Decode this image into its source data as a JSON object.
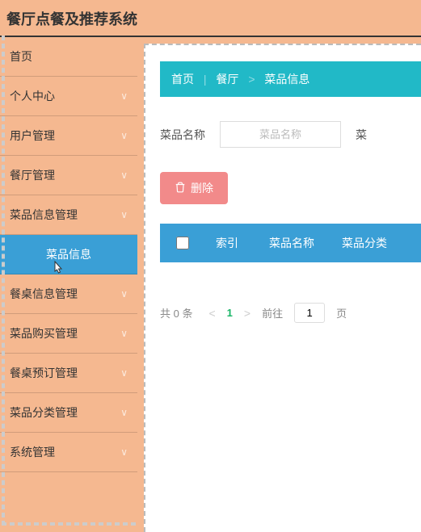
{
  "header": {
    "title": "餐厅点餐及推荐系统"
  },
  "sidebar": {
    "items": [
      {
        "label": "首页",
        "hasChevron": false
      },
      {
        "label": "个人中心",
        "hasChevron": true
      },
      {
        "label": "用户管理",
        "hasChevron": true
      },
      {
        "label": "餐厅管理",
        "hasChevron": true
      },
      {
        "label": "菜品信息管理",
        "hasChevron": true
      },
      {
        "label": "菜品信息",
        "active": true
      },
      {
        "label": "餐桌信息管理",
        "hasChevron": true
      },
      {
        "label": "菜品购买管理",
        "hasChevron": true
      },
      {
        "label": "餐桌预订管理",
        "hasChevron": true
      },
      {
        "label": "菜品分类管理",
        "hasChevron": true
      },
      {
        "label": "系统管理",
        "hasChevron": true
      }
    ]
  },
  "breadcrumb": {
    "home": "首页",
    "section": "餐厅",
    "current": "菜品信息"
  },
  "filters": {
    "name_label": "菜品名称",
    "name_placeholder": "菜品名称",
    "cat_label": "菜"
  },
  "actions": {
    "delete_label": "删除"
  },
  "table": {
    "headers": {
      "index": "索引",
      "name": "菜品名称",
      "category": "菜品分类"
    }
  },
  "pagination": {
    "total_text": "共 0 条",
    "current_page": "1",
    "goto_label": "前往",
    "goto_value": "1",
    "page_suffix": "页"
  }
}
